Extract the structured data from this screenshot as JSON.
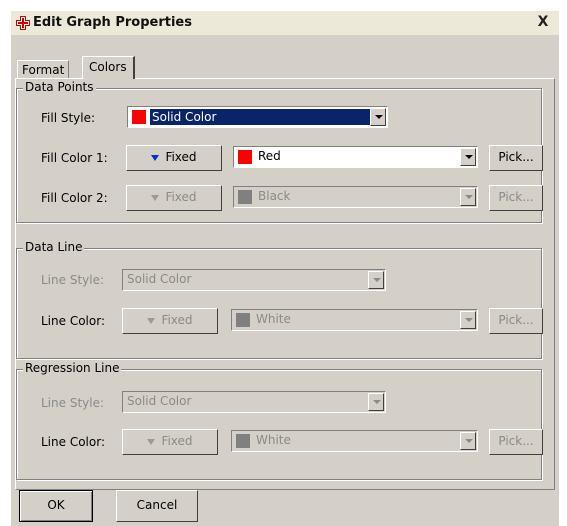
{
  "window": {
    "title": "Edit Graph Properties",
    "close_label": "X"
  },
  "tabs": [
    {
      "label": "Format"
    },
    {
      "label": "Colors"
    }
  ],
  "data_points": {
    "title": "Data Points",
    "fill_style_label": "Fill Style:",
    "fill_style_value": "Solid Color",
    "fill_color1_label": "Fill Color 1:",
    "fill_color1_mode": "Fixed",
    "fill_color1_value": "Red",
    "fill_color1_hex": "#ff0000",
    "fill_color1_pick": "Pick...",
    "fill_color2_label": "Fill Color 2:",
    "fill_color2_mode": "Fixed",
    "fill_color2_value": "Black",
    "fill_color2_pick": "Pick..."
  },
  "data_line": {
    "title": "Data Line",
    "line_style_label": "Line Style:",
    "line_style_value": "Solid Color",
    "line_color_label": "Line Color:",
    "line_color_mode": "Fixed",
    "line_color_value": "White",
    "line_color_pick": "Pick..."
  },
  "regression_line": {
    "title": "Regression Line",
    "line_style_label": "Line Style:",
    "line_style_value": "Solid Color",
    "line_color_label": "Line Color:",
    "line_color_mode": "Fixed",
    "line_color_value": "White",
    "line_color_pick": "Pick..."
  },
  "footer": {
    "ok_label": "OK",
    "cancel_label": "Cancel"
  },
  "colors": {
    "selection": "#0a246a",
    "dialog_bg": "#d4d0c8",
    "disabled_swatch": "#808080"
  }
}
